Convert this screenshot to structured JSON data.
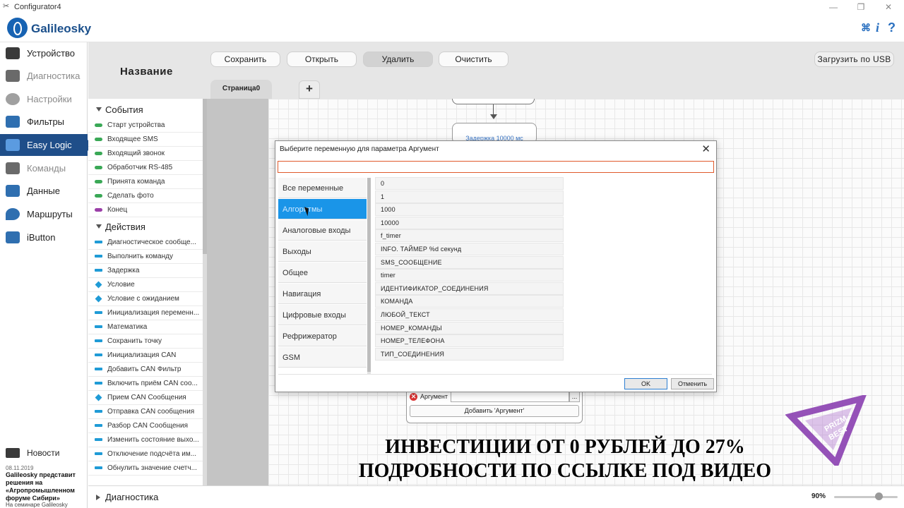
{
  "window": {
    "title": "Configurator4",
    "controls": [
      "—",
      "❐",
      "✕"
    ]
  },
  "header": {
    "logo_text": "Galileosky",
    "icons": [
      "translate-icon",
      "info-icon",
      "help-icon"
    ],
    "info_glyph": "i",
    "help_glyph": "?"
  },
  "sidebar": {
    "items": [
      {
        "label": "Устройство",
        "icon": "device-icon",
        "color": "#3a3a3a"
      },
      {
        "label": "Диагностика",
        "icon": "diagnostics-icon",
        "color": "#555555"
      },
      {
        "label": "Настройки",
        "icon": "settings-icon",
        "color": "#888888"
      },
      {
        "label": "Фильтры",
        "icon": "filters-icon",
        "color": "#2f6fb0"
      },
      {
        "label": "Easy Logic",
        "icon": "easy-logic-icon",
        "color": "#2f6fb0"
      },
      {
        "label": "Команды",
        "icon": "commands-icon",
        "color": "#555555"
      },
      {
        "label": "Данные",
        "icon": "data-icon",
        "color": "#2f6fb0"
      },
      {
        "label": "Маршруты",
        "icon": "routes-icon",
        "color": "#2f6fb0"
      },
      {
        "label": "iButton",
        "icon": "ibutton-icon",
        "color": "#2f6fb0"
      }
    ],
    "active_index": 4,
    "news": {
      "title": "Новости",
      "date": "08.11.2019",
      "text": "Galileosky представит решения на «Агропромышленном форуме Сибири»",
      "subtext": "На семинаре Galileosky"
    }
  },
  "editor": {
    "page_title": "Название",
    "toolbar": {
      "save": "Сохранить",
      "open": "Открыть",
      "delete": "Удалить",
      "clear": "Очистить",
      "usb": "Загрузить по USB"
    },
    "tabs": [
      {
        "label": "Страница0"
      }
    ],
    "add_tab": "+",
    "canvas": {
      "delay_node": "Задержка 10000 мс",
      "argument_label": "Аргумент",
      "argument_value": "",
      "dots": "...",
      "add_argument": "Добавить 'Аргумент'"
    }
  },
  "blocks": {
    "events": {
      "title": "События",
      "items": [
        {
          "label": "Старт устройства",
          "color": "#3aa856",
          "shape": "pill"
        },
        {
          "label": "Входящее SMS",
          "color": "#3aa856",
          "shape": "pill"
        },
        {
          "label": "Входящий звонок",
          "color": "#3aa856",
          "shape": "pill"
        },
        {
          "label": "Обработчик RS-485",
          "color": "#3aa856",
          "shape": "pill"
        },
        {
          "label": "Принята команда",
          "color": "#3aa856",
          "shape": "pill"
        },
        {
          "label": "Сделать фото",
          "color": "#3aa856",
          "shape": "pill"
        },
        {
          "label": "Конец",
          "color": "#9b3fa8",
          "shape": "pill"
        }
      ]
    },
    "actions": {
      "title": "Действия",
      "items": [
        {
          "label": "Диагностическое сообще...",
          "color": "#1f9bd6",
          "shape": "bar"
        },
        {
          "label": "Выполнить команду",
          "color": "#1f9bd6",
          "shape": "bar"
        },
        {
          "label": "Задержка",
          "color": "#1f9bd6",
          "shape": "bar"
        },
        {
          "label": "Условие",
          "color": "#1f9bd6",
          "shape": "diamond"
        },
        {
          "label": "Условие с ожиданием",
          "color": "#1f9bd6",
          "shape": "diamond"
        },
        {
          "label": "Инициализация переменн...",
          "color": "#1f9bd6",
          "shape": "bar"
        },
        {
          "label": "Математика",
          "color": "#1f9bd6",
          "shape": "bar"
        },
        {
          "label": "Сохранить точку",
          "color": "#1f9bd6",
          "shape": "bar"
        },
        {
          "label": "Инициализация CAN",
          "color": "#1f9bd6",
          "shape": "bar"
        },
        {
          "label": "Добавить CAN Фильтр",
          "color": "#1f9bd6",
          "shape": "bar"
        },
        {
          "label": "Включить приём CAN соо...",
          "color": "#1f9bd6",
          "shape": "bar"
        },
        {
          "label": "Прием CAN Сообщения",
          "color": "#1f9bd6",
          "shape": "diamond"
        },
        {
          "label": "Отправка CAN сообщения",
          "color": "#1f9bd6",
          "shape": "bar"
        },
        {
          "label": "Разбор CAN Сообщения",
          "color": "#1f9bd6",
          "shape": "bar"
        },
        {
          "label": "Изменить состояние выхо...",
          "color": "#1f9bd6",
          "shape": "bar"
        },
        {
          "label": "Отключение подсчёта им...",
          "color": "#1f9bd6",
          "shape": "bar"
        },
        {
          "label": "Обнулить значение счетч...",
          "color": "#1f9bd6",
          "shape": "bar"
        }
      ]
    }
  },
  "bottom": {
    "section": "Диагностика",
    "zoom": "90%",
    "zoom_fraction": 0.7
  },
  "dialog": {
    "title": "Выберите переменную для параметра Аргумент",
    "close": "✕",
    "search_value": "",
    "categories": [
      "Все переменные",
      "Алгоритмы",
      "Аналоговые входы",
      "Выходы",
      "Общее",
      "Навигация",
      "Цифровые входы",
      "Рефрижератор",
      "GSM"
    ],
    "selected_category": 1,
    "values": [
      "0",
      "1",
      "1000",
      "10000",
      "f_timer",
      "INFO. ТАЙМЕР %d секунд",
      "SMS_СООБЩЕНИЕ",
      "timer",
      "ИДЕНТИФИКАТОР_СОЕДИНЕНИЯ",
      "КОМАНДА",
      "ЛЮБОЙ_ТЕКСТ",
      "НОМЕР_КОМАНДЫ",
      "НОМЕР_ТЕЛЕФОНА",
      "ТИП_СОЕДИНЕНИЯ"
    ],
    "ok": "OK",
    "cancel": "Отменить"
  },
  "overlay": {
    "line1": "ИНВЕСТИЦИИ ОТ 0 РУБЛЕЙ ДО 27%",
    "line2": "ПОДРОБНОСТИ ПО ССЫЛКЕ ПОД ВИДЕО",
    "logo_text1": "PRIZM",
    "logo_text2": "BEST"
  }
}
